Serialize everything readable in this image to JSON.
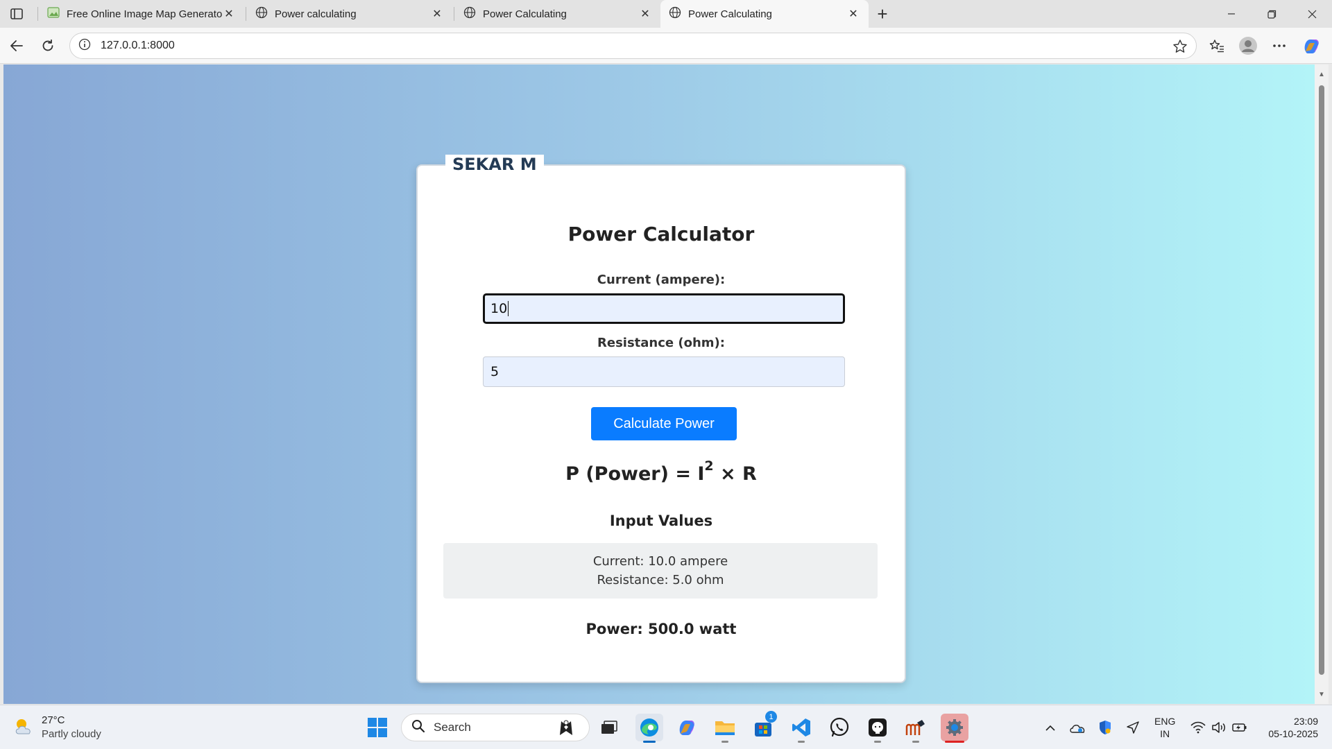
{
  "browser": {
    "tabs": [
      {
        "label": "Free Online Image Map Generator",
        "active": false
      },
      {
        "label": "Power calculating",
        "active": false
      },
      {
        "label": "Power Calculating",
        "active": false
      },
      {
        "label": "Power Calculating",
        "active": true
      }
    ],
    "url": "127.0.0.1:8000"
  },
  "page": {
    "owner": "SEKAR M",
    "title": "Power Calculator",
    "current_label": "Current (ampere):",
    "current_value": "10",
    "resistance_label": "Resistance (ohm):",
    "resistance_value": "5",
    "button_label": "Calculate Power",
    "formula_prefix": "P (Power) = I",
    "formula_exponent": "2",
    "formula_suffix": " × R",
    "input_values_title": "Input Values",
    "current_display": "Current: 10.0 ampere",
    "resistance_display": "Resistance: 5.0 ohm",
    "power_result": "Power: 500.0 watt"
  },
  "taskbar": {
    "weather_temp": "27°C",
    "weather_desc": "Partly cloudy",
    "search_placeholder": "Search",
    "store_badge": "1",
    "lang_top": "ENG",
    "lang_bottom": "IN",
    "time": "23:09",
    "date": "05-10-2025"
  },
  "colors": {
    "button": "#0a7cff",
    "title_text": "#243b55",
    "gradient_start": "#87a7d5",
    "gradient_end": "#b3f4f8"
  }
}
